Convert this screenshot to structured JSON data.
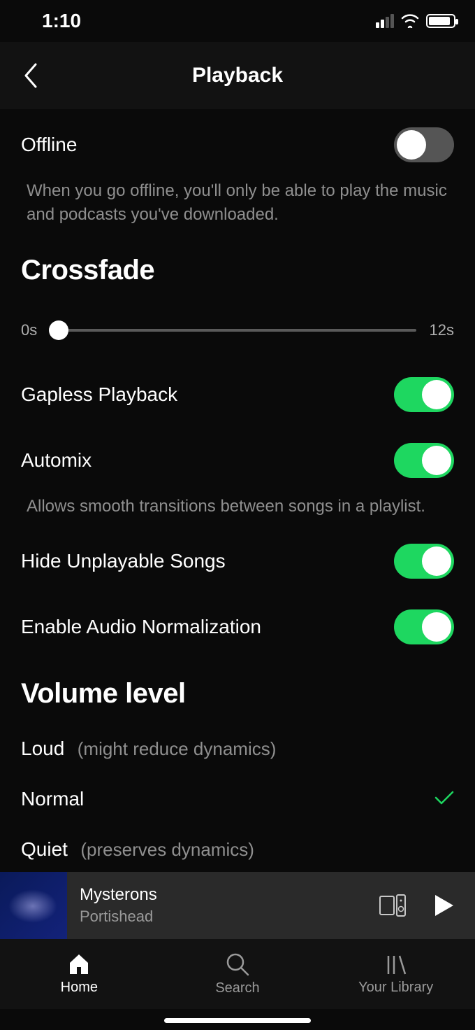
{
  "status": {
    "time": "1:10"
  },
  "header": {
    "title": "Playback"
  },
  "settings": {
    "offline": {
      "label": "Offline",
      "enabled": false,
      "description": "When you go offline, you'll only be able to play the music and podcasts you've downloaded."
    },
    "crossfade": {
      "title": "Crossfade",
      "min_label": "0s",
      "max_label": "12s",
      "value": 0,
      "max": 12
    },
    "gapless": {
      "label": "Gapless Playback",
      "enabled": true
    },
    "automix": {
      "label": "Automix",
      "enabled": true,
      "description": "Allows smooth transitions between songs in a playlist."
    },
    "hide_unplayable": {
      "label": "Hide Unplayable Songs",
      "enabled": true
    },
    "normalization": {
      "label": "Enable Audio Normalization",
      "enabled": true
    }
  },
  "volume_level": {
    "title": "Volume level",
    "options": [
      {
        "label": "Loud",
        "hint": "(might reduce dynamics)",
        "selected": false
      },
      {
        "label": "Normal",
        "hint": "",
        "selected": true
      },
      {
        "label": "Quiet",
        "hint": "(preserves dynamics)",
        "selected": false
      }
    ]
  },
  "now_playing": {
    "title": "Mysterons",
    "artist": "Portishead"
  },
  "tabs": {
    "home": "Home",
    "search": "Search",
    "library": "Your Library"
  }
}
